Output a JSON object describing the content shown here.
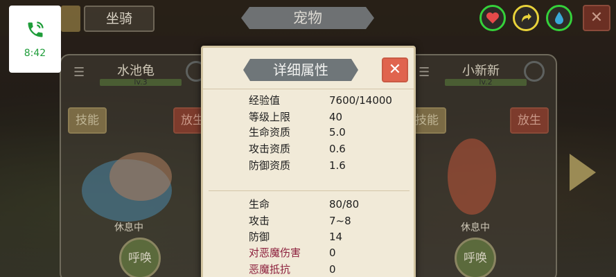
{
  "call": {
    "time": "8:42"
  },
  "tabs": {
    "mount": "坐骑",
    "pet": "宠物"
  },
  "top_right": {
    "close": "✕"
  },
  "colors": {
    "heart": "#e54a4a",
    "ring_green": "#35d23a",
    "ring_yellow": "#e8d23a",
    "water": "#3aa8d8"
  },
  "left_card": {
    "name": "水池龟",
    "level": "lv.3",
    "skill": "技能",
    "release": "放生",
    "status": "休息中",
    "summon": "呼唤"
  },
  "right_card": {
    "name": "小新新",
    "level": "lv.2",
    "skill": "技能",
    "release": "放生",
    "status": "休息中",
    "summon": "呼唤"
  },
  "popup": {
    "title": "详细属性",
    "close": "✕",
    "attributes": [
      {
        "label": "经验值",
        "value": "7600/14000"
      },
      {
        "label": "等级上限",
        "value": "40"
      },
      {
        "label": "生命资质",
        "value": "5.0"
      },
      {
        "label": "攻击资质",
        "value": "0.6"
      },
      {
        "label": "防御资质",
        "value": "1.6"
      }
    ],
    "stats": [
      {
        "label": "生命",
        "value": "80/80"
      },
      {
        "label": "攻击",
        "value": "7~8"
      },
      {
        "label": "防御",
        "value": "14"
      },
      {
        "label": "对恶魔伤害",
        "value": "0"
      },
      {
        "label": "恶魔抵抗",
        "value": "0"
      }
    ]
  }
}
